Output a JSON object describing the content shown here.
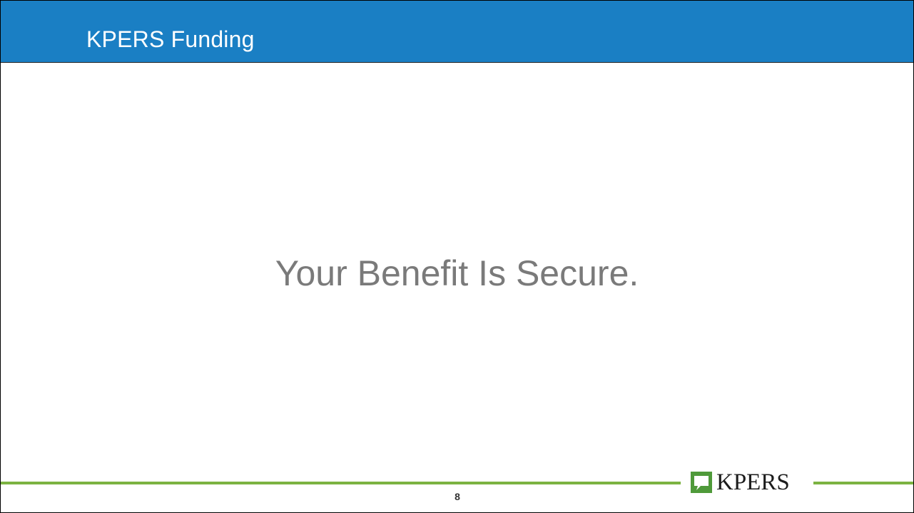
{
  "header": {
    "title": "KPERS Funding"
  },
  "main": {
    "statement": "Your Benefit Is Secure."
  },
  "footer": {
    "logo_text": "KPERS",
    "page_number": "8",
    "logo_icon": "speech-bubble-icon"
  },
  "colors": {
    "header_bar": "#1a7fc4",
    "footer_line": "#7cb342",
    "statement_text": "#7a7a7a",
    "logo_mark": "#4f9a3a"
  }
}
